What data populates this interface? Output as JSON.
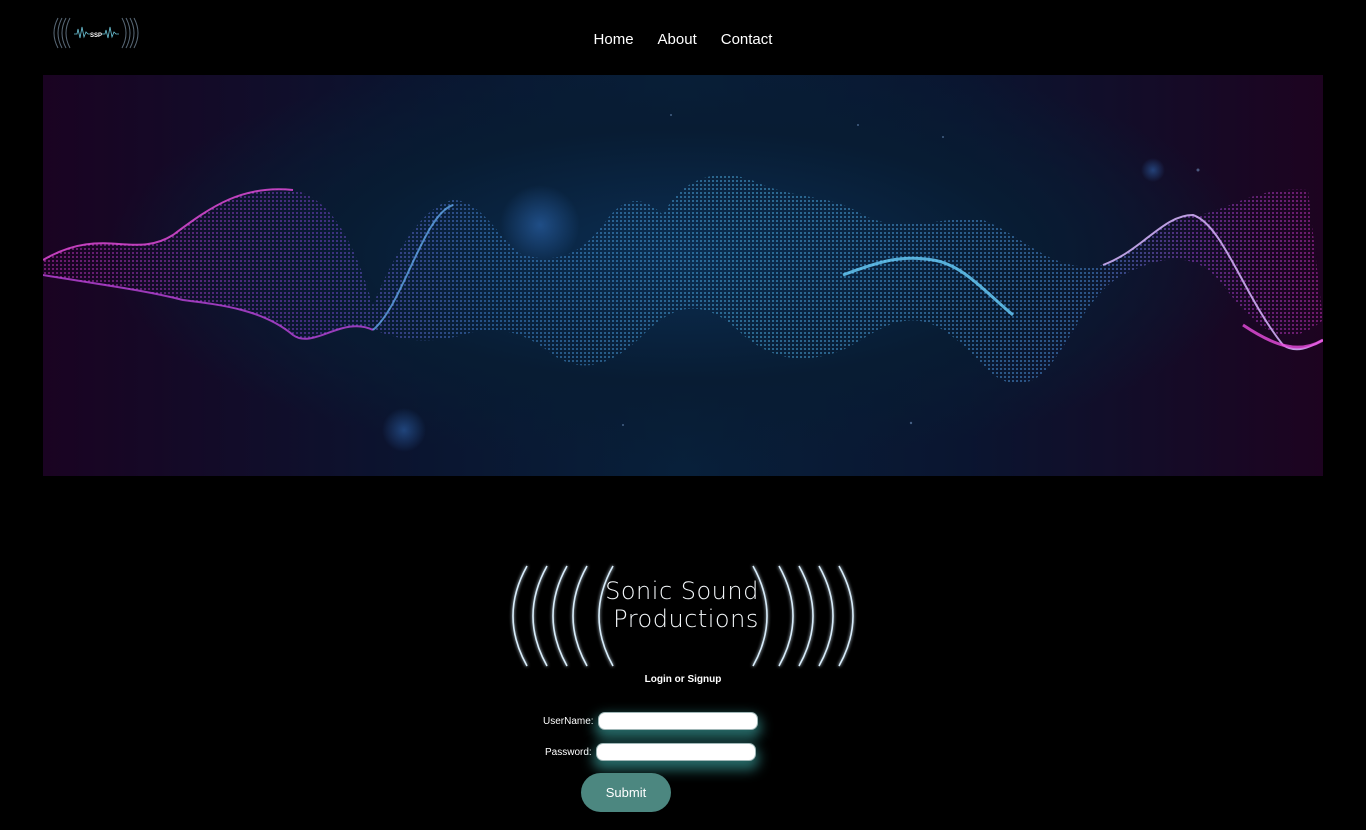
{
  "header": {
    "logo_text": "SSP",
    "nav": [
      "Home",
      "About",
      "Contact"
    ]
  },
  "hero": {
    "image": "abstract-sound-wave-banner"
  },
  "brand": {
    "line1": "Sonic Sound",
    "line2": "Productions"
  },
  "auth": {
    "heading": "Login or Signup",
    "username_label": "UserName:",
    "username_value": "",
    "password_label": "Password:",
    "password_value": "",
    "submit_label": "Submit"
  },
  "colors": {
    "background": "#000000",
    "accent": "#4c8780",
    "wave_pink": "#d33ad8",
    "wave_blue": "#4cc6ff"
  }
}
